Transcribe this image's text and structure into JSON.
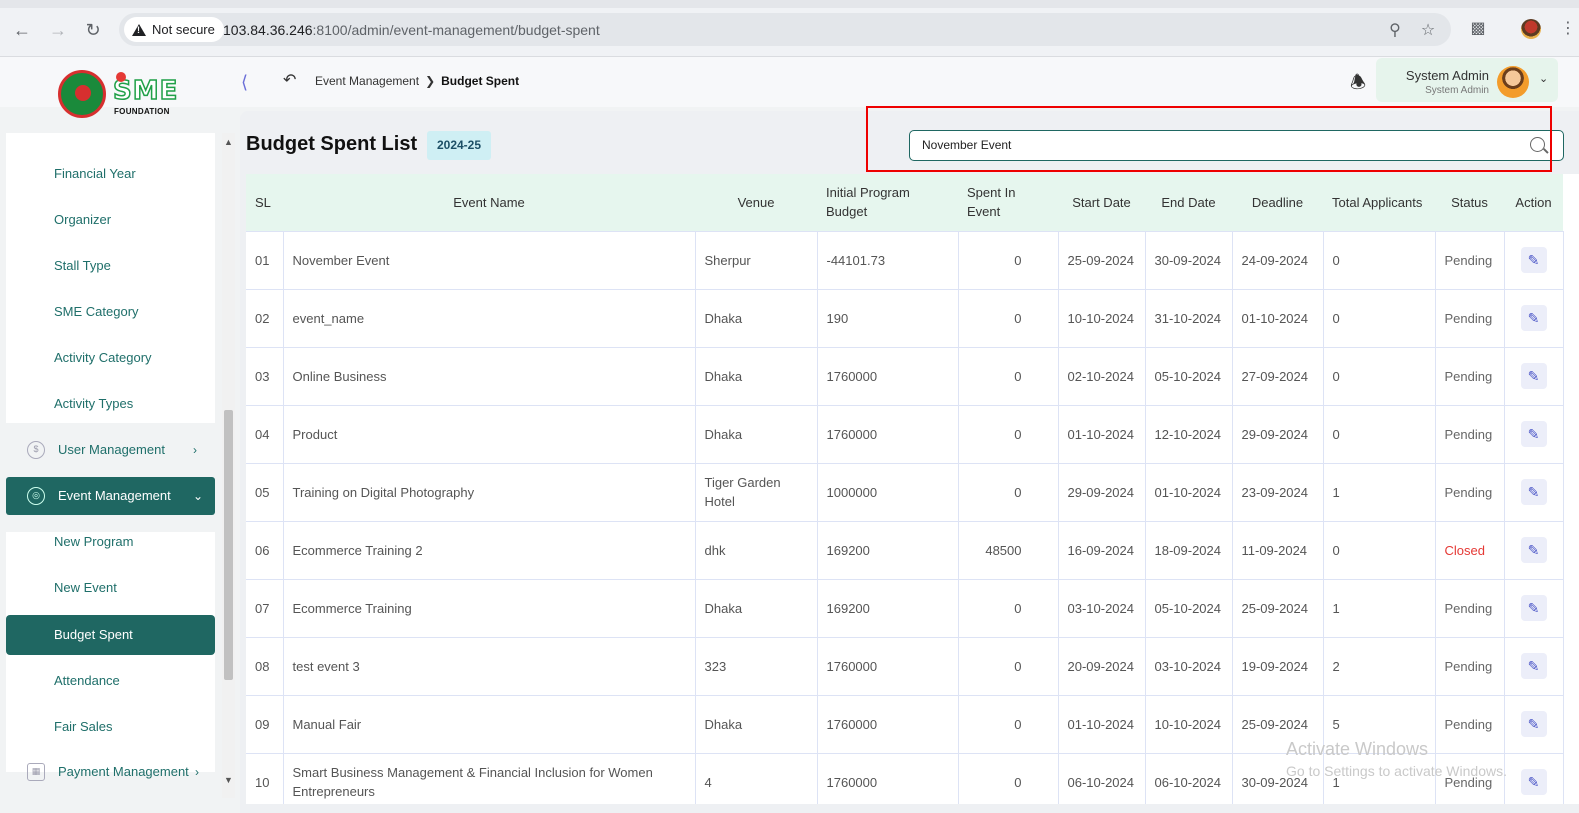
{
  "browser": {
    "not_secure": "Not secure",
    "url_host": "103.84.36.246",
    "url_rest": ":8100/admin/event-management/budget-spent"
  },
  "header": {
    "logo_text": "SME",
    "logo_subtext": "FOUNDATION",
    "breadcrumb": [
      "Event Management",
      "Budget Spent"
    ],
    "user_name": "System Admin",
    "user_role": "System Admin"
  },
  "sidebar": {
    "items": [
      {
        "label": "Financial Year"
      },
      {
        "label": "Organizer"
      },
      {
        "label": "Stall Type"
      },
      {
        "label": "SME Category"
      },
      {
        "label": "Activity Category"
      },
      {
        "label": "Activity Types"
      }
    ],
    "user_management": "User Management",
    "event_management": "Event Management",
    "event_items": [
      {
        "label": "New Program"
      },
      {
        "label": "New Event"
      },
      {
        "label": "Budget Spent"
      },
      {
        "label": "Attendance"
      },
      {
        "label": "Fair Sales"
      }
    ],
    "payment_management": "Payment Management"
  },
  "page": {
    "title": "Budget Spent List",
    "year_badge": "2024-25",
    "search_value": "November Event"
  },
  "table": {
    "headers": [
      "SL",
      "Event Name",
      "Venue",
      "Initial Program Budget",
      "Spent In Event",
      "Start Date",
      "End Date",
      "Deadline",
      "Total Applicants",
      "Status",
      "Action"
    ],
    "rows": [
      {
        "sl": "01",
        "name": "November Event",
        "venue": "Sherpur",
        "budget": "-44101.73",
        "spent": "0",
        "start": "25-09-2024",
        "end": "30-09-2024",
        "deadline": "24-09-2024",
        "applicants": "0",
        "status": "Pending"
      },
      {
        "sl": "02",
        "name": "event_name",
        "venue": "Dhaka",
        "budget": "190",
        "spent": "0",
        "start": "10-10-2024",
        "end": "31-10-2024",
        "deadline": "01-10-2024",
        "applicants": "0",
        "status": "Pending"
      },
      {
        "sl": "03",
        "name": "Online Business",
        "venue": "Dhaka",
        "budget": "1760000",
        "spent": "0",
        "start": "02-10-2024",
        "end": "05-10-2024",
        "deadline": "27-09-2024",
        "applicants": "0",
        "status": "Pending"
      },
      {
        "sl": "04",
        "name": "Product",
        "venue": "Dhaka",
        "budget": "1760000",
        "spent": "0",
        "start": "01-10-2024",
        "end": "12-10-2024",
        "deadline": "29-09-2024",
        "applicants": "0",
        "status": "Pending"
      },
      {
        "sl": "05",
        "name": "Training on Digital Photography",
        "venue": "Tiger Garden Hotel",
        "budget": "1000000",
        "spent": "0",
        "start": "29-09-2024",
        "end": "01-10-2024",
        "deadline": "23-09-2024",
        "applicants": "1",
        "status": "Pending"
      },
      {
        "sl": "06",
        "name": "Ecommerce Training 2",
        "venue": "dhk",
        "budget": "169200",
        "spent": "48500",
        "start": "16-09-2024",
        "end": "18-09-2024",
        "deadline": "11-09-2024",
        "applicants": "0",
        "status": "Closed"
      },
      {
        "sl": "07",
        "name": "Ecommerce Training",
        "venue": "Dhaka",
        "budget": "169200",
        "spent": "0",
        "start": "03-10-2024",
        "end": "05-10-2024",
        "deadline": "25-09-2024",
        "applicants": "1",
        "status": "Pending"
      },
      {
        "sl": "08",
        "name": "test event 3",
        "venue": "323",
        "budget": "1760000",
        "spent": "0",
        "start": "20-09-2024",
        "end": "03-10-2024",
        "deadline": "19-09-2024",
        "applicants": "2",
        "status": "Pending"
      },
      {
        "sl": "09",
        "name": "Manual Fair",
        "venue": "Dhaka",
        "budget": "1760000",
        "spent": "0",
        "start": "01-10-2024",
        "end": "10-10-2024",
        "deadline": "25-09-2024",
        "applicants": "5",
        "status": "Pending"
      },
      {
        "sl": "10",
        "name": "Smart Business Management & Financial Inclusion for Women Entrepreneurs",
        "venue": "4",
        "budget": "1760000",
        "spent": "0",
        "start": "06-10-2024",
        "end": "06-10-2024",
        "deadline": "30-09-2024",
        "applicants": "1",
        "status": "Pending"
      }
    ]
  },
  "watermark": {
    "line1": "Activate Windows",
    "line2": "Go to Settings to activate Windows."
  },
  "colors": {
    "primary": "#1f6762",
    "header_bg": "#e6f6ee",
    "closed": "#e53935",
    "highlight_box": "#ee0000"
  }
}
